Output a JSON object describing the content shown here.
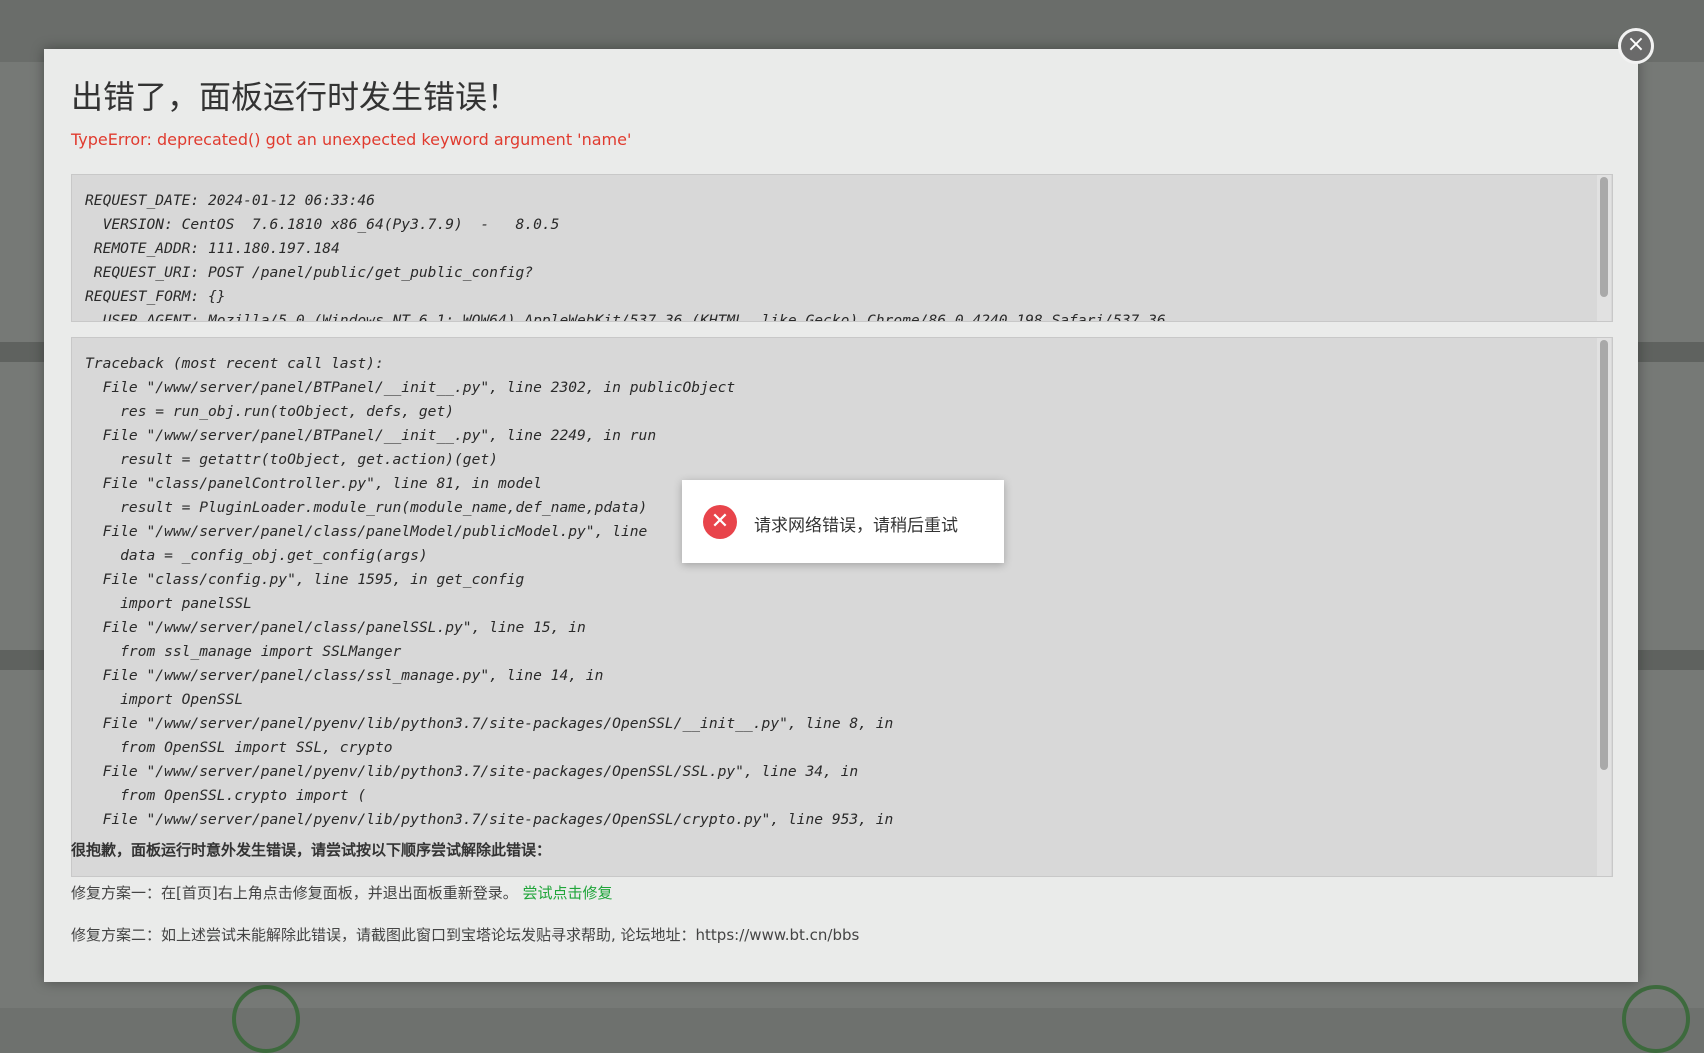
{
  "modal": {
    "close_label": "×",
    "title": "出错了，面板运行时发生错误！",
    "error_message": "TypeError: deprecated() got an unexpected keyword argument 'name'"
  },
  "request_info": {
    "lines": [
      "REQUEST_DATE: 2024-01-12 06:33:46",
      "  VERSION: CentOS  7.6.1810 x86_64(Py3.7.9)  -   8.0.5",
      " REMOTE_ADDR: 111.180.197.184",
      " REQUEST_URI: POST /panel/public/get_public_config?",
      "REQUEST_FORM: {}",
      "  USER_AGENT: Mozilla/5.0 (Windows NT 6.1; WOW64) AppleWebKit/537.36 (KHTML, like Gecko) Chrome/86.0.4240.198 Safari/537.36"
    ]
  },
  "traceback": {
    "lines": [
      "Traceback (most recent call last):",
      "  File \"/www/server/panel/BTPanel/__init__.py\", line 2302, in publicObject",
      "    res = run_obj.run(toObject, defs, get)",
      "  File \"/www/server/panel/BTPanel/__init__.py\", line 2249, in run",
      "    result = getattr(toObject, get.action)(get)",
      "  File \"class/panelController.py\", line 81, in model",
      "    result = PluginLoader.module_run(module_name,def_name,pdata)",
      "  File \"/www/server/panel/class/panelModel/publicModel.py\", line",
      "    data = _config_obj.get_config(args)",
      "  File \"class/config.py\", line 1595, in get_config",
      "    import panelSSL",
      "  File \"/www/server/panel/class/panelSSL.py\", line 15, in",
      "    from ssl_manage import SSLManger",
      "  File \"/www/server/panel/class/ssl_manage.py\", line 14, in",
      "    import OpenSSL",
      "  File \"/www/server/panel/pyenv/lib/python3.7/site-packages/OpenSSL/__init__.py\", line 8, in",
      "    from OpenSSL import SSL, crypto",
      "  File \"/www/server/panel/pyenv/lib/python3.7/site-packages/OpenSSL/SSL.py\", line 34, in",
      "    from OpenSSL.crypto import (",
      "  File \"/www/server/panel/pyenv/lib/python3.7/site-packages/OpenSSL/crypto.py\", line 953, in"
    ]
  },
  "help": {
    "heading": "很抱歉，面板运行时意外发生错误，请尝试按以下顺序尝试解除此错误：",
    "fix1_text": "修复方案一：在[首页]右上角点击修复面板，并退出面板重新登录。",
    "fix1_link": "尝试点击修复",
    "fix2_text": "修复方案二：如上述尝试未能解除此错误，请截图此窗口到宝塔论坛发贴寻求帮助, 论坛地址：https://www.bt.cn/bbs"
  },
  "toast": {
    "icon": "error-icon",
    "message": "请求网络错误，请稍后重试"
  }
}
